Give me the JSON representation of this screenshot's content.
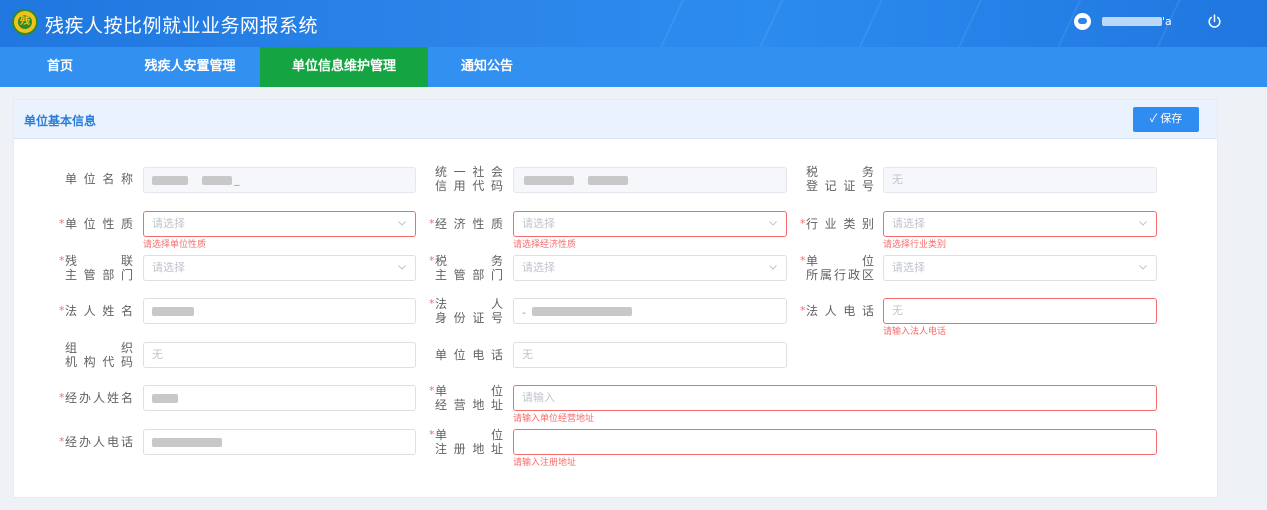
{
  "app": {
    "title": "残疾人按比例就业业务网报系统",
    "user_suffix": "'a"
  },
  "nav": {
    "items": [
      "首页",
      "残疾人安置管理",
      "单位信息维护管理",
      "通知公告"
    ],
    "active": 2
  },
  "panel": {
    "title": "单位基本信息",
    "save_label": "✓ 保存"
  },
  "form": {
    "unit_name": {
      "label": "单位名称",
      "value_tail": "_"
    },
    "credit_code": {
      "label1": "统一社会",
      "label2": "信用代码"
    },
    "tax_reg": {
      "label1": "税务",
      "label2": "登记证号",
      "value": "无"
    },
    "unit_nature": {
      "label": "单位性质",
      "placeholder": "请选择",
      "error": "请选择单位性质"
    },
    "econ_nature": {
      "label": "经济性质",
      "placeholder": "请选择",
      "error": "请选择经济性质"
    },
    "industry": {
      "label": "行业类别",
      "placeholder": "请选择",
      "error": "请选择行业类别"
    },
    "disab_dept": {
      "label1": "残联",
      "label2": "主管部门",
      "placeholder": "请选择"
    },
    "tax_dept": {
      "label1": "税务",
      "label2": "主管部门",
      "placeholder": "请选择"
    },
    "admin_region": {
      "label1": "单位",
      "label2": "所属行政区",
      "placeholder": "请选择"
    },
    "legal_name": {
      "label": "法人姓名"
    },
    "legal_id": {
      "label1": "法人",
      "label2": "身份证号",
      "value_prefix": "-"
    },
    "legal_phone": {
      "label": "法人电话",
      "value": "无",
      "error": "请输入法人电话"
    },
    "org_code": {
      "label1": "组织",
      "label2": "机构代码",
      "value": "无"
    },
    "unit_phone": {
      "label": "单位电话",
      "value": "无"
    },
    "handler_name": {
      "label": "经办人姓名"
    },
    "biz_addr": {
      "label1": "单位",
      "label2": "经营地址",
      "placeholder": "请输入",
      "error": "请输入单位经营地址"
    },
    "handler_phone": {
      "label": "经办人电话"
    },
    "reg_addr": {
      "label1": "单位",
      "label2": "注册地址",
      "error": "请输入注册地址"
    }
  },
  "colors": {
    "header": "#2c86ea",
    "nav": "#3190f0",
    "nav_active": "#14a542",
    "error": "#f56c6c",
    "accent": "#2b7ddb"
  }
}
